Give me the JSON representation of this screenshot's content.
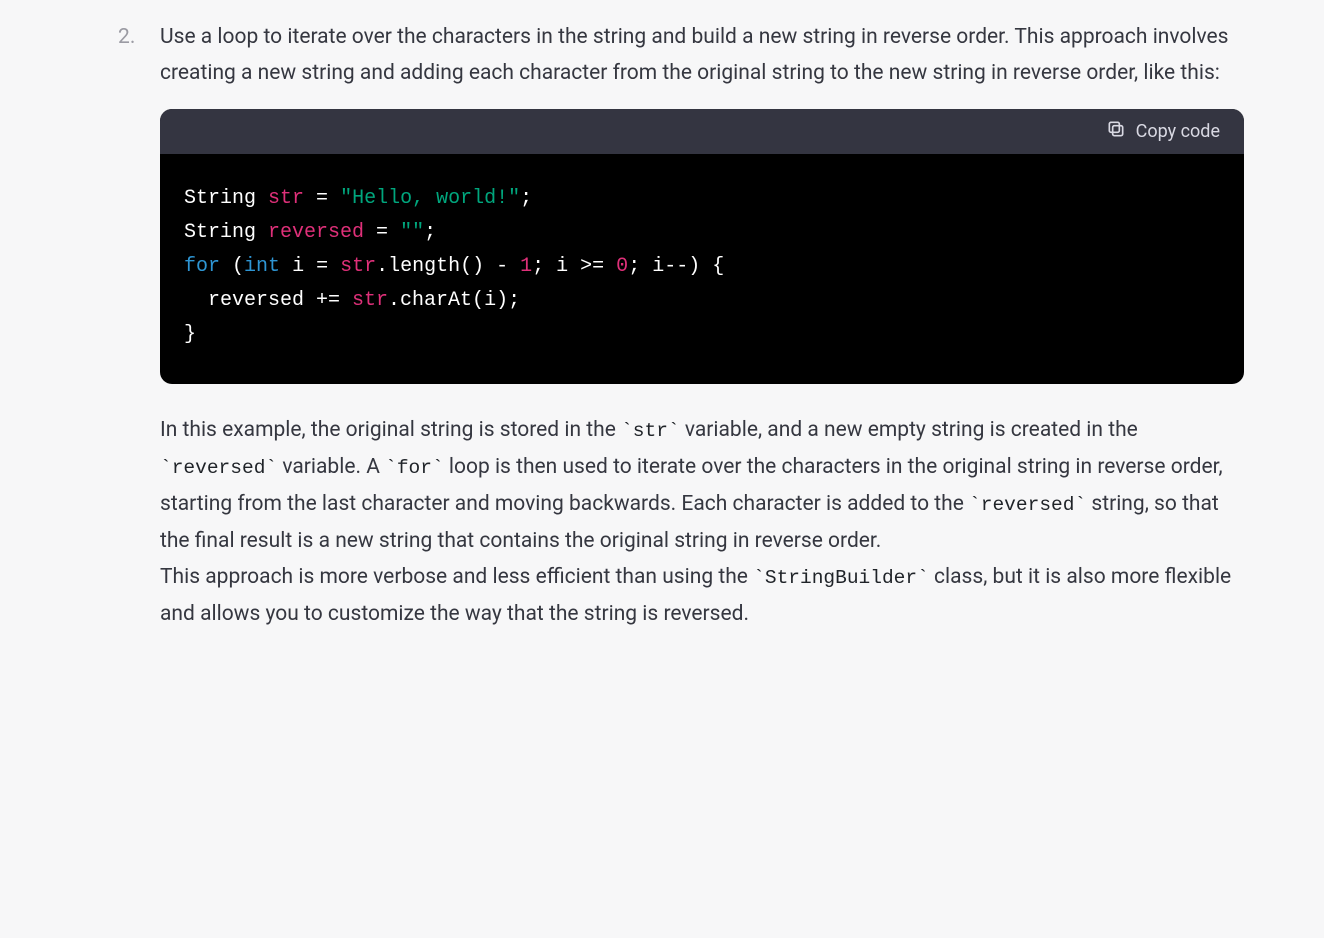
{
  "list_item": {
    "number": "2.",
    "intro": "Use a loop to iterate over the characters in the string and build a new string in reverse order. This approach involves creating a new string and adding each character from the original string to the new string in reverse order, like this:"
  },
  "code": {
    "copy_label": "Copy code",
    "line1": {
      "type": "String",
      "var": "str",
      "assign": " = ",
      "value": "\"Hello, world!\"",
      "end": ";"
    },
    "line2": {
      "type": "String",
      "var": "reversed",
      "assign": " = ",
      "value": "\"\"",
      "end": ";"
    },
    "line3": {
      "for_kw": "for",
      "open": " (",
      "int_kw": "int",
      "space": " ",
      "i": "i",
      "assign": " = ",
      "str_var": "str",
      "call": ".length() - ",
      "one": "1",
      "mid": "; i >= ",
      "zero": "0",
      "tail": "; i--) {"
    },
    "line4": {
      "pre": "  reversed += ",
      "str_var": "str",
      "tail": ".charAt(i);"
    },
    "line5": {
      "text": "}"
    }
  },
  "explanation": {
    "p1_a": "In this example, the original string is stored in the ",
    "p1_code1": "`str`",
    "p1_b": " variable, and a new empty string is created in the ",
    "p1_code2": "`reversed`",
    "p1_c": " variable. A ",
    "p1_code3": "`for`",
    "p1_d": " loop is then used to iterate over the characters in the original string in reverse order, starting from the last character and moving backwards. Each character is added to the ",
    "p1_code4": "`reversed`",
    "p1_e": " string, so that the final result is a new string that contains the original string in reverse order.",
    "p2_a": "This approach is more verbose and less efficient than using the ",
    "p2_code1": "`StringBuilder`",
    "p2_b": " class, but it is also more flexible and allows you to customize the way that the string is reversed."
  }
}
